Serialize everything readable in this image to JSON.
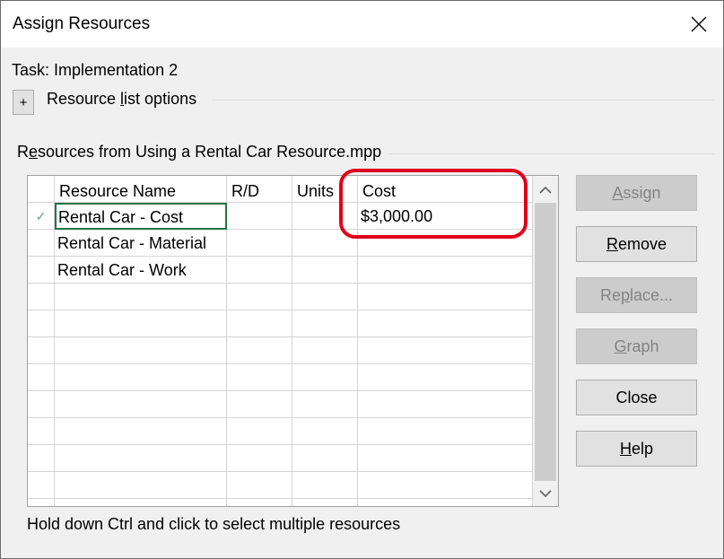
{
  "window": {
    "title": "Assign Resources"
  },
  "task_label": "Task: Implementation 2",
  "resource_options": {
    "expander_symbol": "+",
    "label_before": "Resource ",
    "label_accel": "l",
    "label_after": "ist options"
  },
  "resources_from": {
    "label_before": "R",
    "label_accel": "e",
    "label_after": "sources from Using a Rental Car Resource.mpp"
  },
  "grid": {
    "columns": [
      "Resource Name",
      "R/D",
      "Units",
      "Cost"
    ],
    "rows": [
      {
        "assigned": "✓",
        "name": "Rental Car - Cost",
        "rd": "",
        "units": "",
        "cost": "$3,000.00"
      },
      {
        "assigned": "",
        "name": "Rental Car - Material",
        "rd": "",
        "units": "",
        "cost": ""
      },
      {
        "assigned": "",
        "name": "Rental Car - Work",
        "rd": "",
        "units": "",
        "cost": ""
      }
    ],
    "empty_rows": 9
  },
  "buttons": [
    {
      "id": "assign",
      "accel": "A",
      "rest": "ssign",
      "pre": "",
      "disabled": true
    },
    {
      "id": "remove",
      "accel": "R",
      "rest": "emove",
      "pre": "",
      "disabled": false
    },
    {
      "id": "replace",
      "pre": "Re",
      "accel": "p",
      "rest": "lace...",
      "disabled": true
    },
    {
      "id": "graph",
      "accel": "G",
      "rest": "raph",
      "pre": "",
      "disabled": true
    },
    {
      "id": "close",
      "pre": "Close",
      "accel": "",
      "rest": "",
      "disabled": false
    },
    {
      "id": "help",
      "accel": "H",
      "rest": "elp",
      "pre": "",
      "disabled": false
    }
  ],
  "hint": "Hold down Ctrl and click to select multiple resources",
  "colors": {
    "highlight": "#e0001b",
    "check": "#6d9f7f",
    "active_cell_border": "#217346"
  }
}
